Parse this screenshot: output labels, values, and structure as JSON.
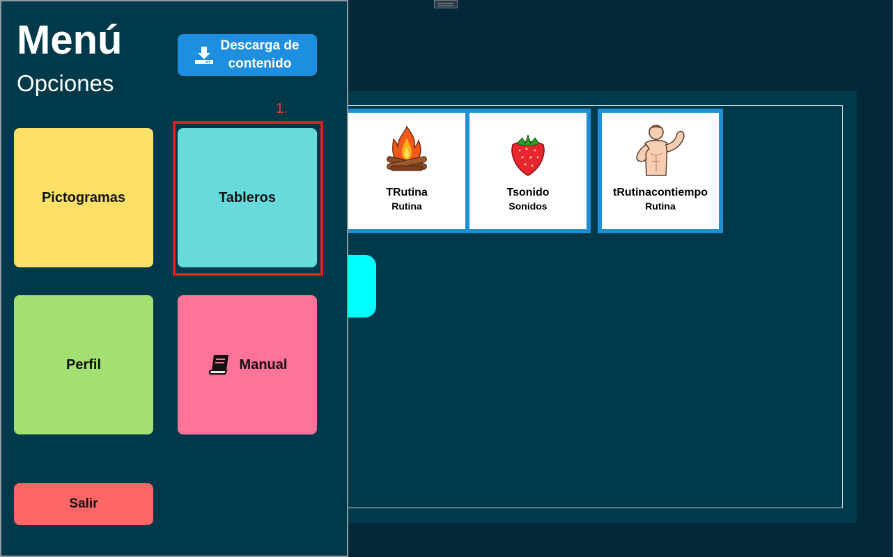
{
  "menu": {
    "title": "Menú",
    "subtitle": "Opciones",
    "download_label": "Descarga de contenido",
    "step_label": "1.",
    "tiles": {
      "pictogramas": "Pictogramas",
      "tableros": "Tableros",
      "perfil": "Perfil",
      "manual": "Manual"
    },
    "exit_label": "Salir"
  },
  "boards": [
    {
      "title": "TRutina",
      "category": "Rutina",
      "icon": "campfire-icon"
    },
    {
      "title": "Tsonido",
      "category": "Sonidos",
      "icon": "strawberry-icon"
    },
    {
      "title": "tRutinacontiempo",
      "category": "Rutina",
      "icon": "strong-man-icon"
    }
  ],
  "colors": {
    "background": "#03283a",
    "panel": "#003a4a",
    "card_border": "#1e8ed6",
    "download_button": "#1e8fe0",
    "tile_pictogramas": "#ffe066",
    "tile_tableros": "#67dbdc",
    "tile_perfil": "#a3e072",
    "tile_manual": "#ff7399",
    "exit_button": "#ff6666",
    "highlight": "#e11d24",
    "cyan_handle": "#00ffff"
  }
}
